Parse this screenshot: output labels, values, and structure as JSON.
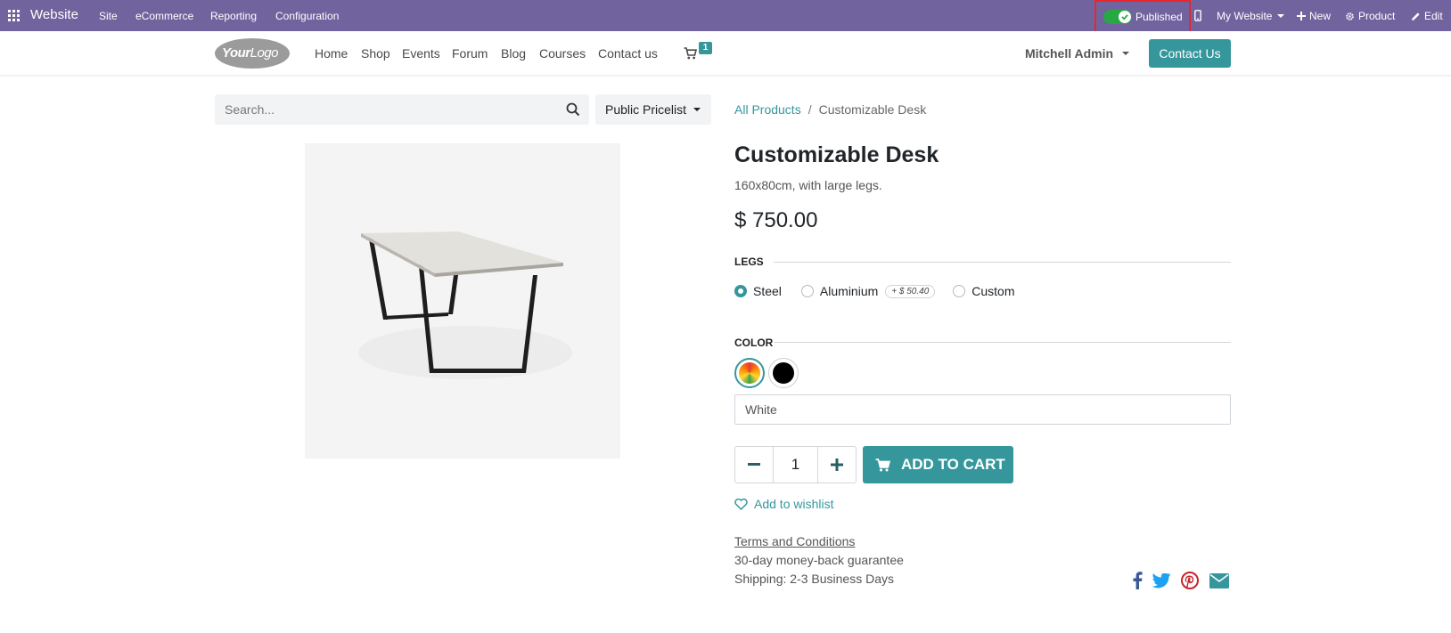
{
  "admin_bar": {
    "brand": "Website",
    "menu": [
      "Site",
      "eCommerce",
      "Reporting",
      "Configuration"
    ],
    "published_label": "Published",
    "my_website_label": "My Website",
    "new_label": "New",
    "product_label": "Product",
    "edit_label": "Edit"
  },
  "site_header": {
    "logo_text_bold": "Your",
    "logo_text_light": "Logo",
    "nav": [
      "Home",
      "Shop",
      "Events",
      "Forum",
      "Blog",
      "Courses",
      "Contact us"
    ],
    "cart_count": "1",
    "user_name": "Mitchell Admin",
    "contact_button": "Contact Us"
  },
  "search": {
    "placeholder": "Search...",
    "pricelist": "Public Pricelist"
  },
  "breadcrumb": {
    "parent": "All Products",
    "separator": "/",
    "current": "Customizable Desk"
  },
  "product": {
    "title": "Customizable Desk",
    "subtitle": "160x80cm, with large legs.",
    "price": "$ 750.00",
    "legs_label": "LEGS",
    "legs_options": [
      {
        "label": "Steel",
        "checked": true
      },
      {
        "label": "Aluminium",
        "checked": false,
        "extra": "+ $ 50.40"
      },
      {
        "label": "Custom",
        "checked": false
      }
    ],
    "color_label": "COLOR",
    "color_swatches": [
      "multicolor",
      "black"
    ],
    "selected_color": "White",
    "quantity": "1",
    "add_to_cart": "ADD TO CART",
    "wishlist": "Add to wishlist",
    "terms": "Terms and Conditions",
    "guarantee": "30-day money-back guarantee",
    "shipping": "Shipping: 2-3 Business Days"
  },
  "colors": {
    "admin_bar": "#71639e",
    "accent": "#35979c",
    "published_toggle": "#28a745",
    "highlight_box": "#e8262b",
    "facebook": "#3b5998",
    "twitter": "#1da1f2",
    "pinterest": "#c8232c",
    "email": "#35979c"
  },
  "share_icons": [
    "facebook-icon",
    "twitter-icon",
    "pinterest-icon",
    "envelope-icon"
  ]
}
